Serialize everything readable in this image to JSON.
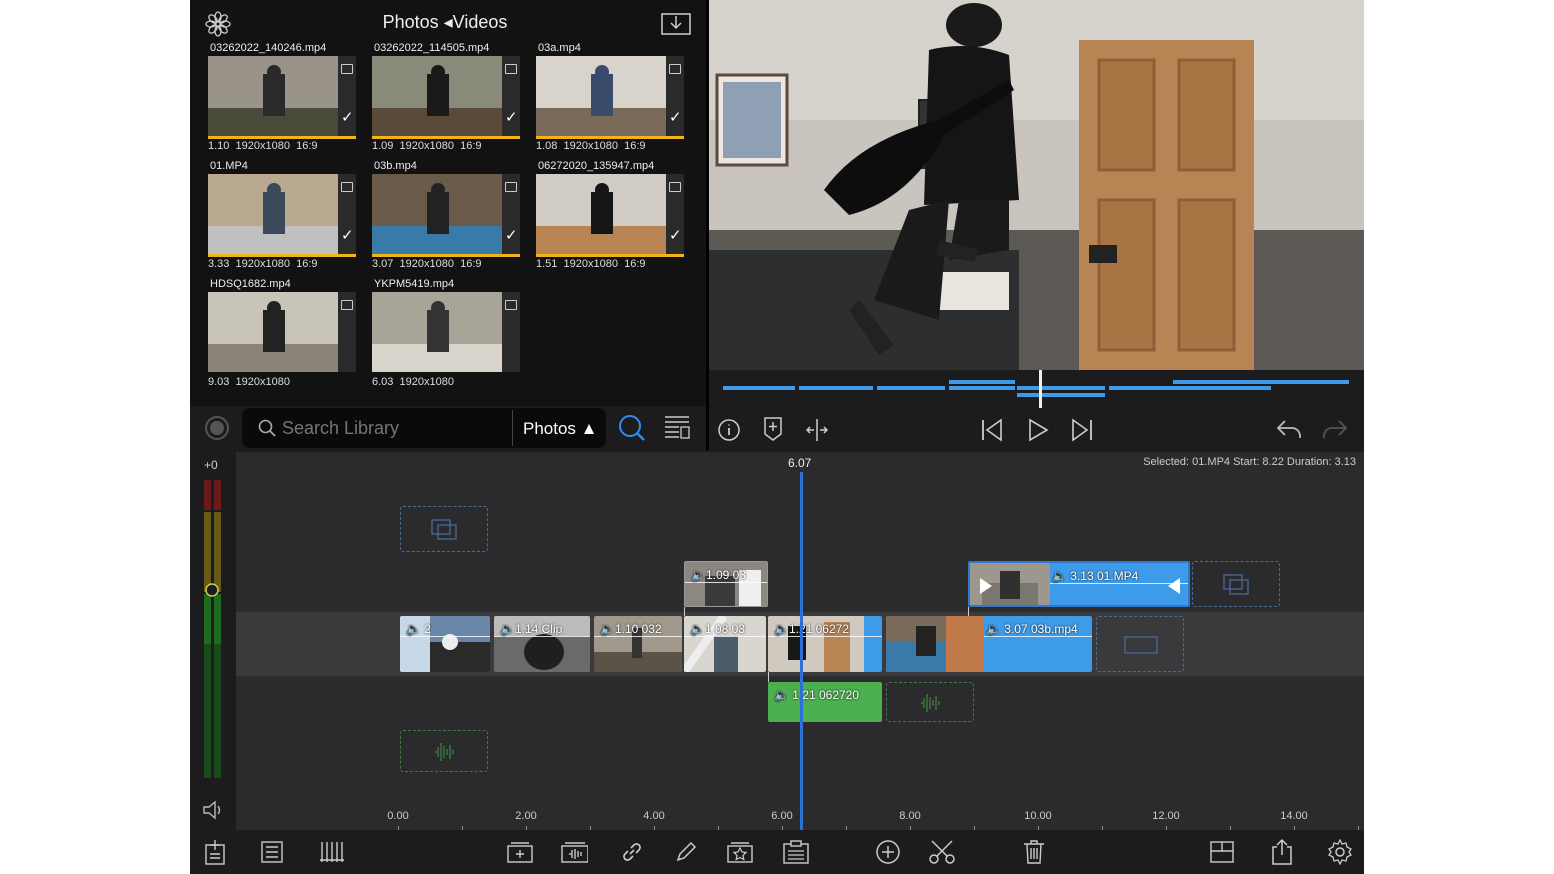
{
  "library": {
    "title": "Photos ◂Videos",
    "items": [
      {
        "name": "03262022_140246.mp4",
        "duration": "1.10",
        "res": "1920x1080",
        "aspect": "16:9",
        "checked": true
      },
      {
        "name": "03262022_114505.mp4",
        "duration": "1.09",
        "res": "1920x1080",
        "aspect": "16:9",
        "checked": true
      },
      {
        "name": "03a.mp4",
        "duration": "1.08",
        "res": "1920x1080",
        "aspect": "16:9",
        "checked": true
      },
      {
        "name": "01.MP4",
        "duration": "3.33",
        "res": "1920x1080",
        "aspect": "16:9",
        "checked": true
      },
      {
        "name": "03b.mp4",
        "duration": "3.07",
        "res": "1920x1080",
        "aspect": "16:9",
        "checked": true
      },
      {
        "name": "06272020_135947.mp4",
        "duration": "1.51",
        "res": "1920x1080",
        "aspect": "16:9",
        "checked": true
      },
      {
        "name": "HDSQ1682.mp4",
        "duration": "9.03",
        "res": "1920x1080",
        "aspect": "",
        "checked": false
      },
      {
        "name": "YKPM5419.mp4",
        "duration": "6.03",
        "res": "1920x1080",
        "aspect": "",
        "checked": false
      }
    ]
  },
  "search": {
    "placeholder": "Search Library",
    "filter": "Photos ▲"
  },
  "timeline": {
    "playhead_time": "6.07",
    "selected_info": "Selected: 01.MP4 Start: 8.22 Duration: 3.13",
    "meter_level": "+0",
    "ruler": [
      "0.00",
      "2.00",
      "4.00",
      "6.00",
      "8.00",
      "10.00",
      "12.00",
      "14.00"
    ],
    "overlay_clips": [
      {
        "label": "🔈1.09  03"
      },
      {
        "label": "🔈 3.13    01.MP4"
      }
    ],
    "main_clips": [
      {
        "label": "🔈 2"
      },
      {
        "label": "🔈1.14  Clip"
      },
      {
        "label": "🔈1.10 032"
      },
      {
        "label": "🔈1.08  03"
      },
      {
        "label": "🔈1.21  06272"
      },
      {
        "label": "🔈 3.07   03b.mp4"
      }
    ],
    "audio_clips": [
      {
        "label": "🔈 1.21  062720"
      }
    ]
  },
  "colors": {
    "accent": "#2e6fd8",
    "clip_selected": "#3d9be9",
    "audio": "#4caf50",
    "library_bar": "#f2b316"
  }
}
